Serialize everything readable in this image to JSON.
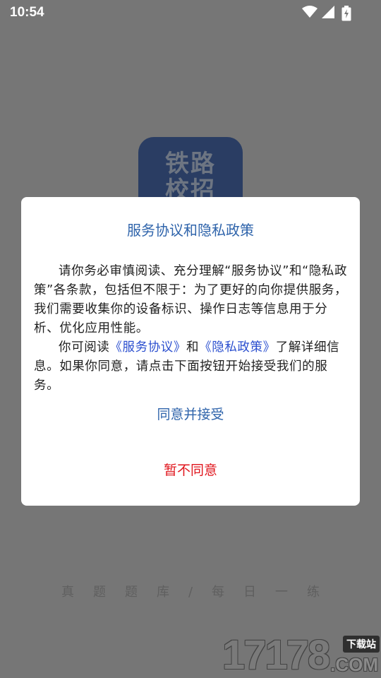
{
  "status_bar": {
    "time": "10:54",
    "icons": [
      "wifi-icon",
      "cellular-signal-icon",
      "battery-charging-icon"
    ]
  },
  "splash": {
    "logo_line1": "铁路",
    "logo_line2": "校招",
    "slogan": "真题题库/每日一练"
  },
  "dialog": {
    "title": "服务协议和隐私政策",
    "paragraph1": "请你务必审慎阅读、充分理解“服务协议”和“隐私政策”各条款，包括但不限于：为了更好的向你提供服务，我们需要收集你的设备标识、操作日志等信息用于分析、优化应用性能。",
    "p2_prefix": "你可阅读",
    "p2_link1": "《服务协议》",
    "p2_and": "和",
    "p2_link2": "《隐私政策》",
    "p2_suffix": "了解详细信息。如果你同意，请点击下面按钮开始接受我们的服务。",
    "agree_label": "同意并接受",
    "decline_label": "暂不同意"
  },
  "watermark": {
    "digits": "17178",
    "badge": "下载站",
    "domain": ".COM"
  },
  "colors": {
    "overlay_bg": "#767676",
    "title_blue": "#2f64ab",
    "link_blue": "#2b4fcf",
    "decline_red": "#e0151c",
    "logo_bg": "#2a3d63"
  }
}
